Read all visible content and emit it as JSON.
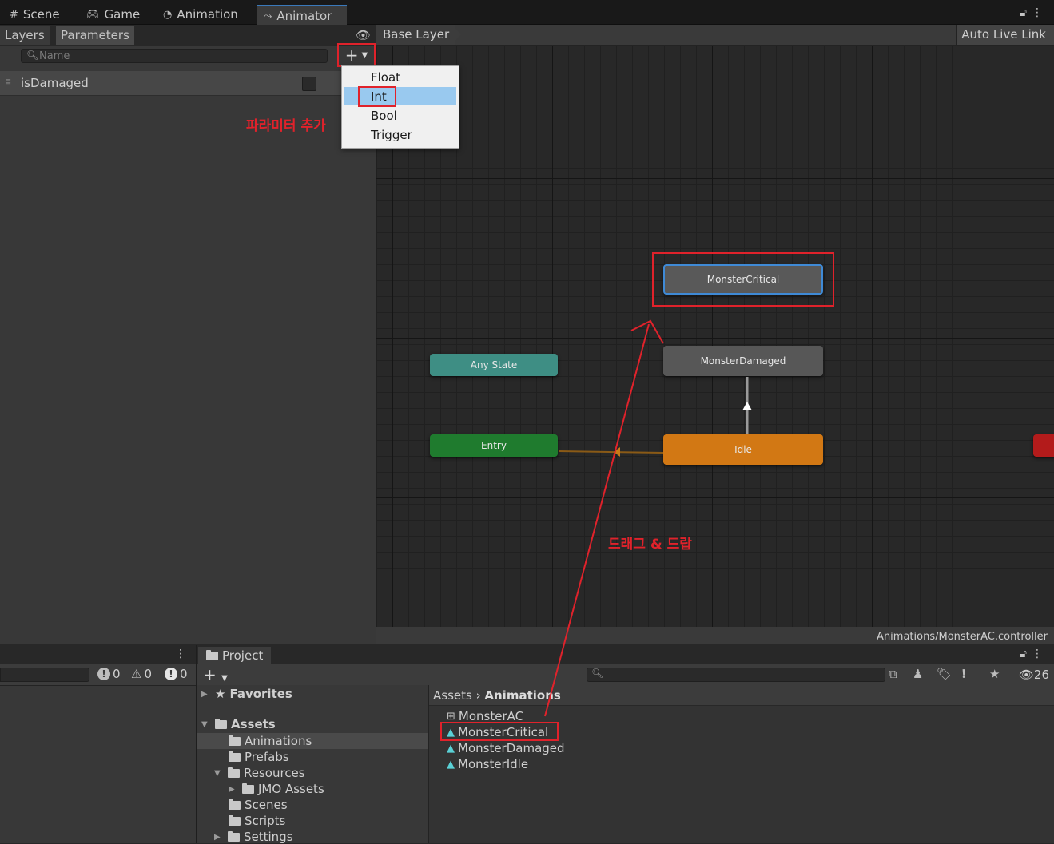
{
  "tabs": [
    {
      "label": "Scene",
      "icon": "hash-icon"
    },
    {
      "label": "Game",
      "icon": "gamepad-icon"
    },
    {
      "label": "Animation",
      "icon": "clock-icon"
    },
    {
      "label": "Animator",
      "icon": "animator-icon"
    }
  ],
  "left_panel": {
    "subtabs": {
      "layers": "Layers",
      "parameters": "Parameters"
    },
    "search_placeholder": "Name",
    "parameters": [
      {
        "name": "isDamaged",
        "type": "Bool",
        "value": false
      }
    ]
  },
  "dropdown": {
    "items": [
      "Float",
      "Int",
      "Bool",
      "Trigger"
    ],
    "highlighted": "Int"
  },
  "annotations": {
    "add_parameter": "파라미터 추가",
    "drag_drop": "드래그 & 드랍"
  },
  "graph": {
    "breadcrumb": "Base Layer",
    "auto_live_link": "Auto Live Link",
    "footer_path": "Animations/MonsterAC.controller",
    "nodes": {
      "critical": "MonsterCritical",
      "damaged": "MonsterDamaged",
      "any_state": "Any State",
      "entry": "Entry",
      "idle": "Idle"
    }
  },
  "console": {
    "errors": "0",
    "warnings": "0",
    "infos": "0"
  },
  "project": {
    "tab": "Project",
    "hidden_count": "26",
    "tree": {
      "favorites": "Favorites",
      "assets": "Assets",
      "folders": [
        "Animations",
        "Prefabs",
        "Resources",
        "JMO Assets",
        "Scenes",
        "Scripts",
        "Settings"
      ]
    },
    "breadcrumb": {
      "root": "Assets",
      "current": "Animations"
    },
    "files": [
      "MonsterAC",
      "MonsterCritical",
      "MonsterDamaged",
      "MonsterIdle"
    ]
  },
  "colors": {
    "highlight_red": "#e0222b",
    "idle_orange": "#d27814",
    "entry_green": "#1f7b2e",
    "any_state_teal": "#3e8e84",
    "selection_blue": "#3f8ad6"
  }
}
